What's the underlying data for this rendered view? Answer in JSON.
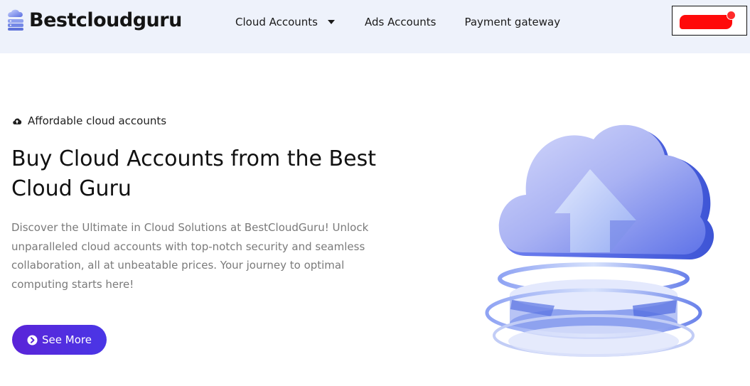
{
  "header": {
    "brand": "Bestcloudguru",
    "nav": [
      {
        "label": "Cloud Accounts",
        "has_dropdown": true
      },
      {
        "label": "Ads Accounts"
      },
      {
        "label": "Payment gateway"
      }
    ],
    "cart": {
      "icon": "cart-icon"
    }
  },
  "hero": {
    "tagline": "Affordable cloud accounts",
    "tagline_icon": "cloud-upload-icon",
    "title": "Buy Cloud Accounts from the Best Cloud Guru",
    "description": "Discover the Ultimate in Cloud Solutions at BestCloudGuru! Unlock unparalleled cloud accounts with top-notch security and seamless collaboration, all at unbeatable prices. Your journey to optimal computing starts here!",
    "cta_label": "See More",
    "cta_icon": "chevron-circle-right-icon",
    "illustration": "cloud-upload-illustration"
  },
  "colors": {
    "header_bg": "#eef2fb",
    "accent": "#5a24d8",
    "text_muted": "#7a7a7a",
    "redaction": "#ff0a0a"
  }
}
